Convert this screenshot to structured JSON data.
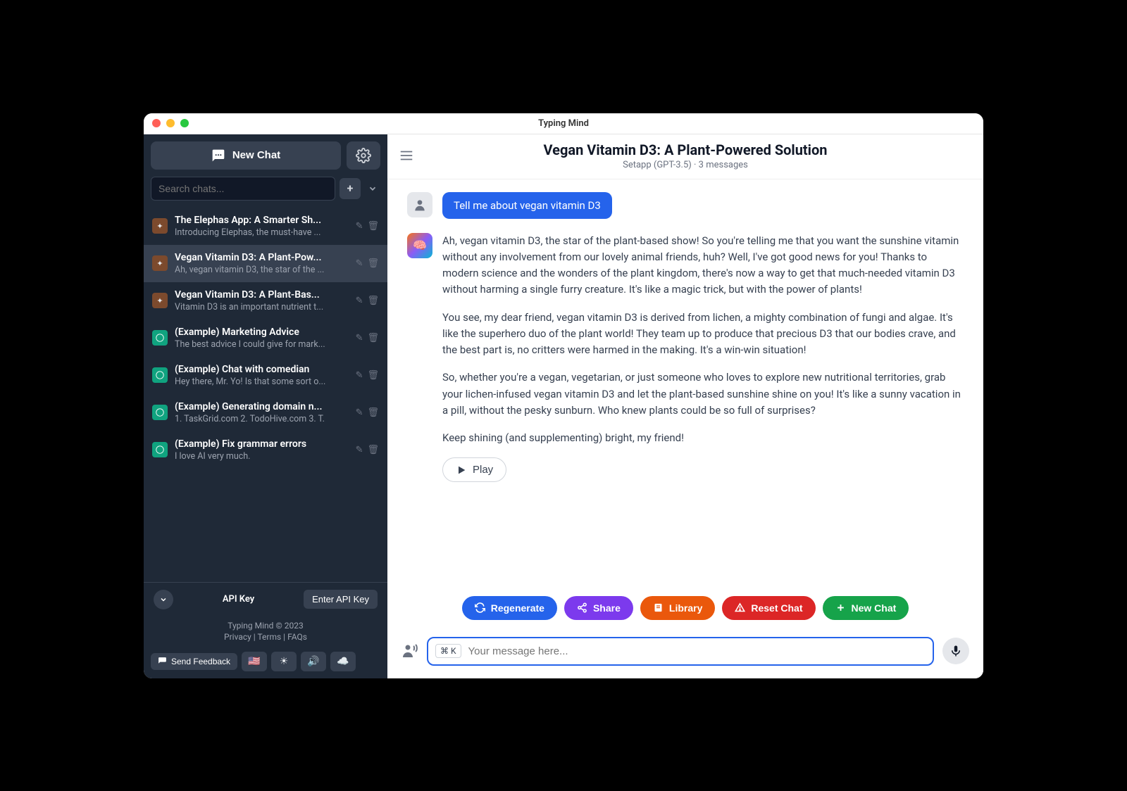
{
  "window": {
    "title": "Typing Mind"
  },
  "sidebar": {
    "newChat": "New Chat",
    "searchPlaceholder": "Search chats...",
    "chats": [
      {
        "title": "The Elephas App: A Smarter Sh...",
        "preview": "Introducing Elephas, the must-have ...",
        "icon": "orange"
      },
      {
        "title": "Vegan Vitamin D3: A Plant-Pow...",
        "preview": "Ah, vegan vitamin D3, the star of the ...",
        "icon": "orange",
        "active": true
      },
      {
        "title": "Vegan Vitamin D3: A Plant-Bas...",
        "preview": "Vitamin D3 is an important nutrient t...",
        "icon": "orange"
      },
      {
        "title": "(Example) Marketing Advice",
        "preview": "The best advice I could give for mark...",
        "icon": "green"
      },
      {
        "title": "(Example) Chat with comedian",
        "preview": "Hey there, Mr. Yo! Is that some sort o...",
        "icon": "green"
      },
      {
        "title": "(Example) Generating domain n...",
        "preview": "1. TaskGrid.com 2. TodoHive.com 3. T.",
        "icon": "green"
      },
      {
        "title": "(Example) Fix grammar errors",
        "preview": "I love AI very much.",
        "icon": "green"
      }
    ],
    "apiKeyLabel": "API Key",
    "enterApiKey": "Enter API Key",
    "copyright": "Typing Mind © 2023",
    "privacy": "Privacy",
    "terms": "Terms",
    "faqs": "FAQs",
    "sendFeedback": "Send Feedback"
  },
  "main": {
    "title": "Vegan Vitamin D3: A Plant-Powered Solution",
    "subtitle": "Setapp (GPT-3.5)  ·  3 messages",
    "userMessage": "Tell me about vegan vitamin D3",
    "aiMessage": {
      "p1": "Ah, vegan vitamin D3, the star of the plant-based show! So you're telling me that you want the sunshine vitamin without any involvement from our lovely animal friends, huh? Well, I've got good news for you! Thanks to modern science and the wonders of the plant kingdom, there's now a way to get that much-needed vitamin D3 without harming a single furry creature. It's like a magic trick, but with the power of plants!",
      "p2": "You see, my dear friend, vegan vitamin D3 is derived from lichen, a mighty combination of fungi and algae. It's like the superhero duo of the plant world! They team up to produce that precious D3 that our bodies crave, and the best part is, no critters were harmed in the making. It's a win-win situation!",
      "p3": "So, whether you're a vegan, vegetarian, or just someone who loves to explore new nutritional territories, grab your lichen-infused vegan vitamin D3 and let the plant-based sunshine shine on you! It's like a sunny vacation in a pill, without the pesky sunburn. Who knew plants could be so full of surprises?",
      "p4": "Keep shining (and supplementing) bright, my friend!"
    },
    "play": "Play",
    "actions": {
      "regenerate": "Regenerate",
      "share": "Share",
      "library": "Library",
      "reset": "Reset Chat",
      "newChat": "New Chat"
    },
    "kbd": "⌘ K",
    "inputPlaceholder": "Your message here..."
  }
}
